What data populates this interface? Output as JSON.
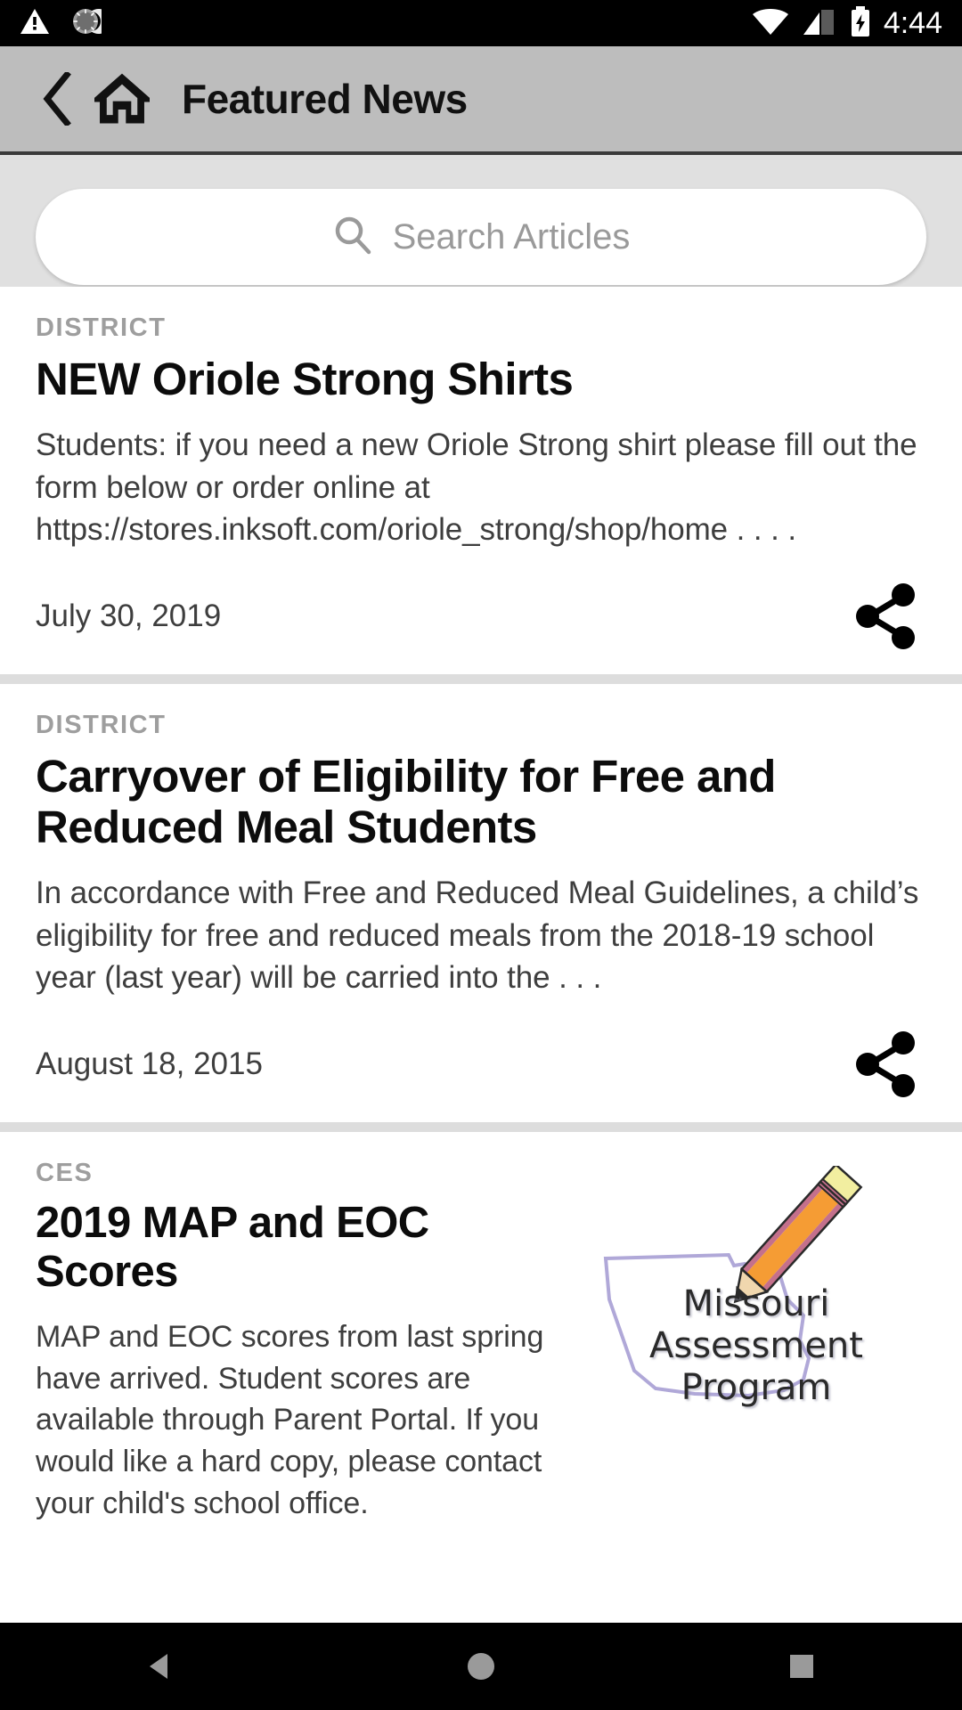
{
  "status_bar": {
    "time": "4:44",
    "icons": [
      "warning-triangle-icon",
      "sync-circle-icon",
      "wifi-icon",
      "cellular-signal-icon",
      "battery-charging-icon"
    ]
  },
  "app_bar": {
    "title": "Featured News",
    "back_icon": "chevron-left-icon",
    "home_icon": "home-icon",
    "background_color": "#bdbdbd"
  },
  "search": {
    "placeholder": "Search Articles",
    "value": "",
    "icon": "search-icon"
  },
  "articles": [
    {
      "category": "DISTRICT",
      "headline": "NEW Oriole Strong Shirts",
      "excerpt": "Students:  if you need a new Oriole Strong shirt please fill out the form below or order online at https://stores.inksoft.com/oriole_strong/shop/home .  . . .",
      "date": "July 30, 2019",
      "share_icon": "share-icon",
      "has_thumbnail": false
    },
    {
      "category": "DISTRICT",
      "headline": "Carryover of Eligibility for Free and Reduced Meal Students",
      "excerpt": "In accordance with Free and Reduced Meal Guidelines, a child’s eligibility for free and reduced meals from the 2018-19 school year (last year) will be carried into the . . .",
      "date": "August 18, 2015",
      "share_icon": "share-icon",
      "has_thumbnail": false
    },
    {
      "category": "CES",
      "headline": "2019 MAP and EOC Scores",
      "excerpt": "MAP and EOC scores from last spring have arrived. Student scores are available through Parent Portal. If you would like a hard copy, please contact your child's school office.",
      "date": "",
      "share_icon": "share-icon",
      "has_thumbnail": true,
      "thumbnail": {
        "name": "missouri-assessment-program-logo",
        "line1": "Missouri",
        "line2": "Assessment",
        "line3": "Program",
        "pencil_body_color": "#f59c34",
        "pencil_edge_color": "#c4708c",
        "eraser_color": "#f2eea0",
        "state_outline_color": "#b0a8d8"
      }
    }
  ],
  "nav_bar": {
    "back_label": "back-triangle-icon",
    "home_label": "home-circle-icon",
    "recents_label": "recents-square-icon"
  },
  "colors": {
    "status_bar_bg": "#000000",
    "app_bar_bg": "#bdbdbd",
    "search_zone_bg": "#e0e0e0",
    "card_bg": "#ffffff",
    "separator": "#dddddd",
    "category_text": "#9e9e9e",
    "body_text": "#3e3e3e"
  }
}
